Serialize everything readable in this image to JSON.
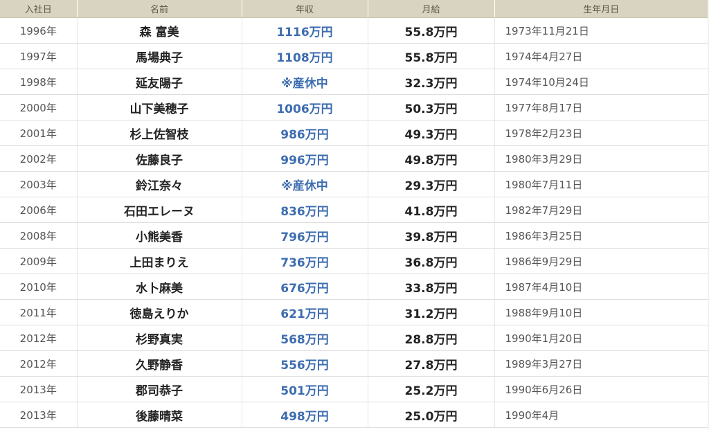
{
  "table": {
    "headers": [
      "入社日",
      "名前",
      "年収",
      "月給",
      "生年月日"
    ],
    "rows": [
      {
        "year": "1996年",
        "name": "森 富美",
        "income": "1116万円",
        "salary": "55.8万円",
        "birth": "1973年11月21日"
      },
      {
        "year": "1997年",
        "name": "馬場典子",
        "income": "1108万円",
        "salary": "55.8万円",
        "birth": "1974年4月27日"
      },
      {
        "year": "1998年",
        "name": "延友陽子",
        "income": "※産休中",
        "salary": "32.3万円",
        "birth": "1974年10月24日"
      },
      {
        "year": "2000年",
        "name": "山下美穂子",
        "income": "1006万円",
        "salary": "50.3万円",
        "birth": "1977年8月17日"
      },
      {
        "year": "2001年",
        "name": "杉上佐智枝",
        "income": "986万円",
        "salary": "49.3万円",
        "birth": "1978年2月23日"
      },
      {
        "year": "2002年",
        "name": "佐藤良子",
        "income": "996万円",
        "salary": "49.8万円",
        "birth": "1980年3月29日"
      },
      {
        "year": "2003年",
        "name": "鈴江奈々",
        "income": "※産休中",
        "salary": "29.3万円",
        "birth": "1980年7月11日"
      },
      {
        "year": "2006年",
        "name": "石田エレーヌ",
        "income": "836万円",
        "salary": "41.8万円",
        "birth": "1982年7月29日"
      },
      {
        "year": "2008年",
        "name": "小熊美香",
        "income": "796万円",
        "salary": "39.8万円",
        "birth": "1986年3月25日"
      },
      {
        "year": "2009年",
        "name": "上田まりえ",
        "income": "736万円",
        "salary": "36.8万円",
        "birth": "1986年9月29日"
      },
      {
        "year": "2010年",
        "name": "水卜麻美",
        "income": "676万円",
        "salary": "33.8万円",
        "birth": "1987年4月10日"
      },
      {
        "year": "2011年",
        "name": "徳島えりか",
        "income": "621万円",
        "salary": "31.2万円",
        "birth": "1988年9月10日"
      },
      {
        "year": "2012年",
        "name": "杉野真実",
        "income": "568万円",
        "salary": "28.8万円",
        "birth": "1990年1月20日"
      },
      {
        "year": "2012年",
        "name": "久野静香",
        "income": "556万円",
        "salary": "27.8万円",
        "birth": "1989年3月27日"
      },
      {
        "year": "2013年",
        "name": "郡司恭子",
        "income": "501万円",
        "salary": "25.2万円",
        "birth": "1990年6月26日"
      },
      {
        "year": "2013年",
        "name": "後藤晴菜",
        "income": "498万円",
        "salary": "25.0万円",
        "birth": "1990年4月"
      }
    ]
  },
  "colors": {
    "header_bg": "#d9d3c1",
    "income_text": "#3d6db0"
  }
}
